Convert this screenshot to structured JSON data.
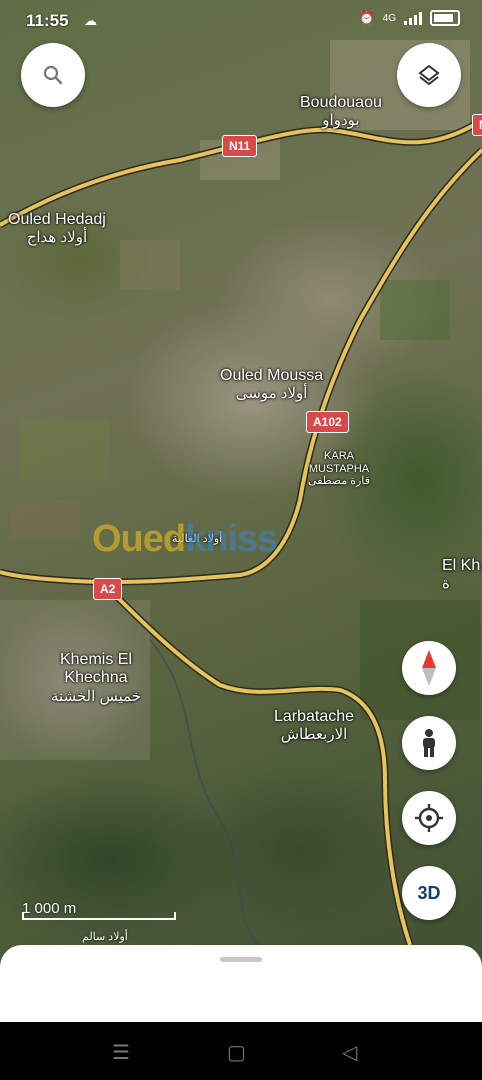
{
  "status_bar": {
    "time": "11:55",
    "left_icon": "notification-icon",
    "right_icons": [
      "alarm-icon",
      "4g-signal-icon",
      "signal-icon",
      "battery-icon"
    ],
    "network": "4G"
  },
  "buttons": {
    "search_icon": "search-icon",
    "layers_icon": "layers-icon",
    "compass_icon": "compass-icon",
    "street_view_icon": "pegman-icon",
    "location_icon": "my-location-icon",
    "three_d_label": "3D"
  },
  "places": [
    {
      "id": "boudouaou",
      "name": "Boudouaou",
      "name_ar": "بودواو"
    },
    {
      "id": "ouled-hedadj",
      "name": "Ouled Hedadj",
      "name_ar": "أولاد هداج"
    },
    {
      "id": "ouled-moussa",
      "name": "Ouled Moussa",
      "name_ar": "أولاد موسى"
    },
    {
      "id": "kara-mustapha",
      "name": "KARA MUSTAPHA",
      "name_ar": "قارة مصطفى"
    },
    {
      "id": "ouled-ghalia",
      "name": "",
      "name_ar": "أولاد الغالية"
    },
    {
      "id": "el-kh",
      "name": "El Kh",
      "name_ar": "ة"
    },
    {
      "id": "khemis-el-khechna",
      "name": "Khemis El Khechna",
      "name_ar": "خميس الخشنة"
    },
    {
      "id": "larbatache",
      "name": "Larbatache",
      "name_ar": "الاربعطاش"
    }
  ],
  "road_shields": [
    "N11",
    "A102",
    "A2",
    "N"
  ],
  "watermark": {
    "part1": "Oued",
    "part2": "kniss"
  },
  "scale": {
    "label": "1 000 m",
    "extra_ar": "أولاد سالم"
  },
  "colors": {
    "road": "#e6c35c",
    "shield": "#d8494a",
    "compass_red": "#e53935"
  }
}
